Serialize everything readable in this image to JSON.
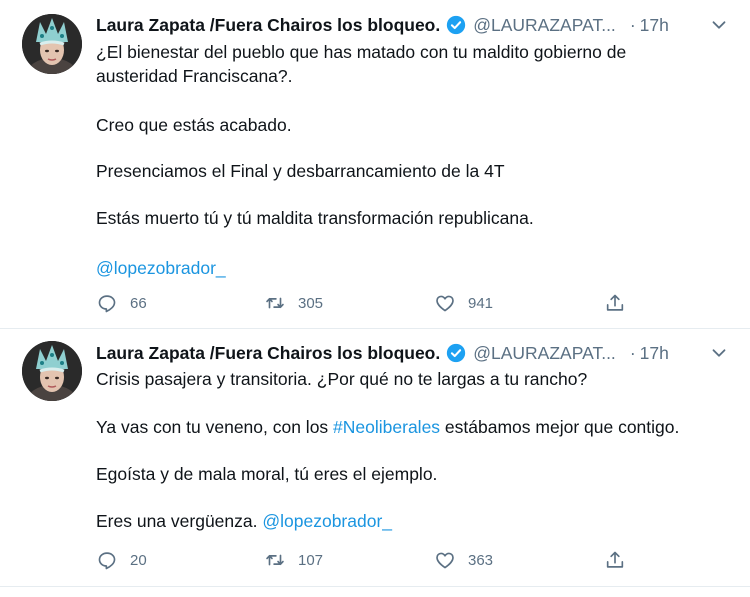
{
  "tweets": [
    {
      "display_name": "Laura Zapata /Fuera Chairos los bloqueo.",
      "handle": "@LAURAZAPAT...",
      "dot": "·",
      "time": "17h",
      "paragraphs": [
        "¿El bienestar del pueblo que has matado con tu maldito gobierno de",
        "austeridad Franciscana?.",
        "Creo que estás acabado.",
        "Presenciamos el Final y desbarrancamiento de la 4T",
        "Estás muerto tú y tú maldita transformación republicana."
      ],
      "mention": "@lopezobrador_",
      "counts": {
        "replies": "66",
        "retweets": "305",
        "likes": "941"
      }
    },
    {
      "display_name": "Laura Zapata /Fuera Chairos los bloqueo.",
      "handle": "@LAURAZAPAT...",
      "dot": "·",
      "time": "17h",
      "paragraphs": [
        "Crisis pasajera y transitoria. ¿Por qué no te largas a tu rancho?",
        "Ya vas con tu veneno, con los ",
        "#Neoliberales",
        " estábamos mejor que contigo.",
        "Egoísta y de mala moral, tú eres el ejemplo.",
        "Eres una vergüenza. ",
        "@lopezobrador_"
      ],
      "counts": {
        "replies": "20",
        "retweets": "107",
        "likes": "363"
      }
    }
  ],
  "icons": {
    "verified": "verified-badge-icon",
    "caret": "chevron-down-icon",
    "reply": "reply-icon",
    "retweet": "retweet-icon",
    "like": "heart-icon",
    "share": "share-icon"
  },
  "colors": {
    "link": "#1b95e0",
    "verified": "#1da1f2",
    "secondary_text": "#5b7083",
    "divider": "#e6ecf0"
  }
}
